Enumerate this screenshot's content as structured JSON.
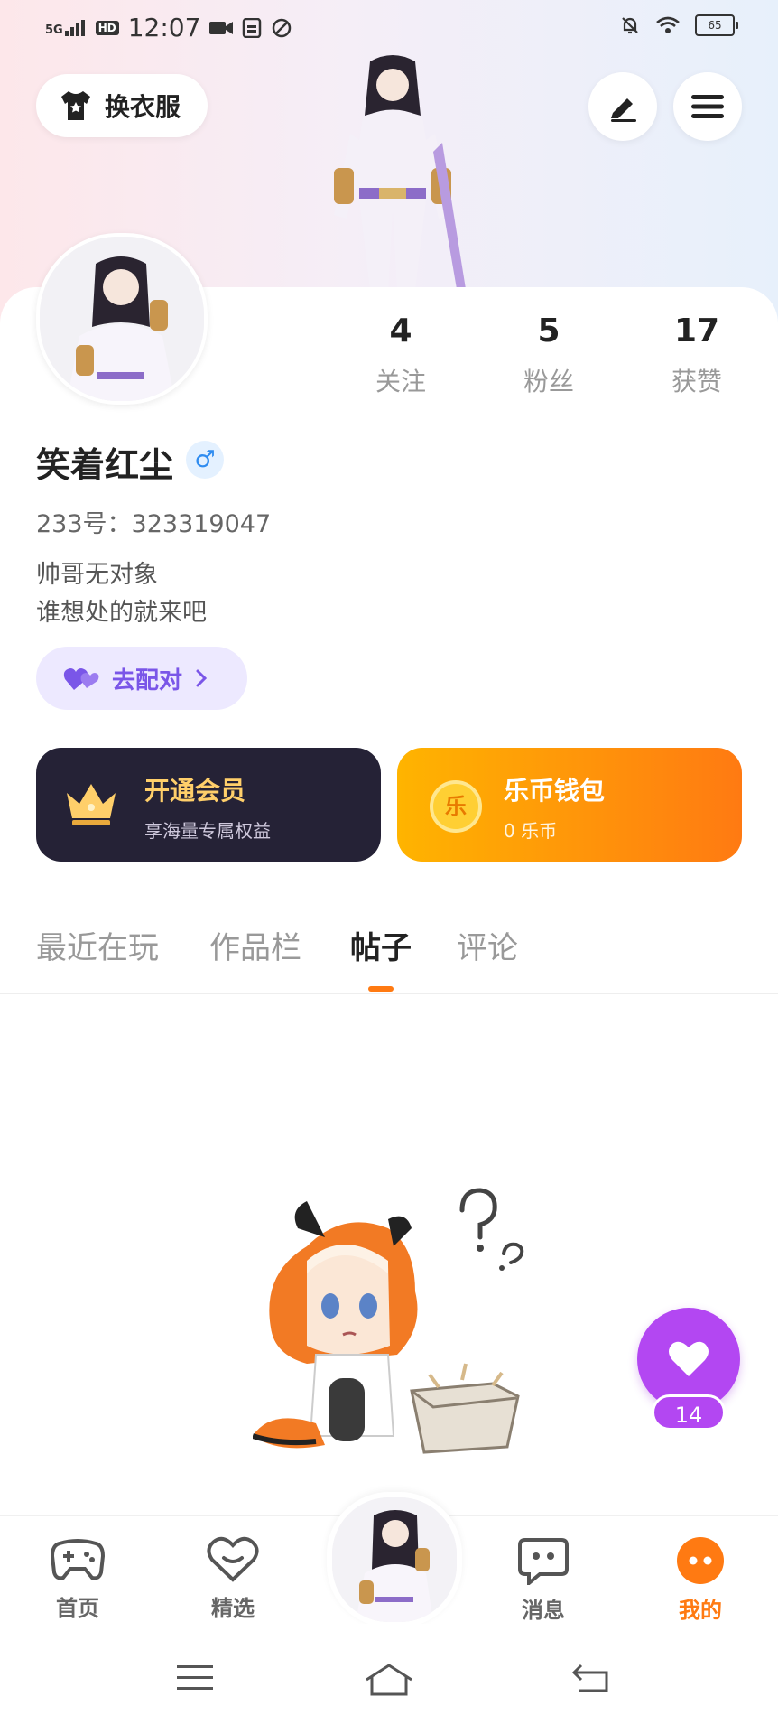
{
  "status_bar": {
    "signal": "5G",
    "hd": "HD",
    "time": "12:07",
    "battery": "65"
  },
  "header": {
    "outfit_button": "换衣服"
  },
  "profile": {
    "username": "笑着红尘",
    "gender_symbol": "♂",
    "id_line": "233号：323319047",
    "bio_line1": "帅哥无对象",
    "bio_line2": "谁想处的就来吧",
    "match_button": "去配对"
  },
  "stats": [
    {
      "value": "4",
      "label": "关注"
    },
    {
      "value": "5",
      "label": "粉丝"
    },
    {
      "value": "17",
      "label": "获赞"
    }
  ],
  "vip_card": {
    "title": "开通会员",
    "subtitle": "享海量专属权益"
  },
  "wallet_card": {
    "coin_glyph": "乐",
    "title": "乐币钱包",
    "subtitle": "0 乐币"
  },
  "tabs": [
    {
      "label": "最近在玩",
      "active": false
    },
    {
      "label": "作品栏",
      "active": false
    },
    {
      "label": "帖子",
      "active": true
    },
    {
      "label": "评论",
      "active": false
    }
  ],
  "floating_like": {
    "count": "14"
  },
  "bottom_nav": [
    {
      "label": "首页",
      "icon": "gamepad-icon",
      "active": false
    },
    {
      "label": "精选",
      "icon": "heart-badge-icon",
      "active": false
    },
    {
      "label": "消息",
      "icon": "chat-icon",
      "active": false
    },
    {
      "label": "我的",
      "icon": "profile-dots-icon",
      "active": true
    }
  ],
  "colors": {
    "accent": "#ff7a12",
    "purple": "#b347f2",
    "vip_bg": "#252236",
    "gold": "#ffcf6a"
  }
}
